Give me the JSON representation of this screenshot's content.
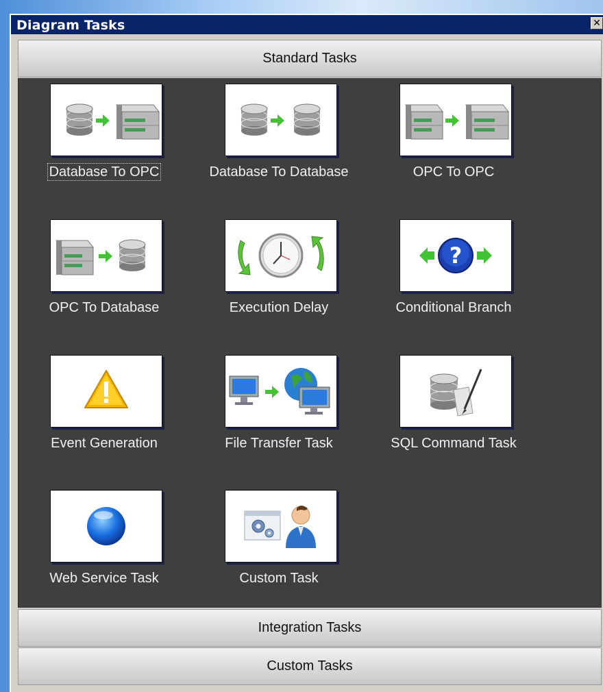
{
  "window": {
    "title": "Diagram Tasks",
    "close_glyph": "✕"
  },
  "sections": {
    "standard": "Standard Tasks",
    "integration": "Integration Tasks",
    "custom": "Custom Tasks"
  },
  "tasks": [
    {
      "label": "Database To OPC",
      "icon": "database-to-opc-icon",
      "focused": true
    },
    {
      "label": "Database To Database",
      "icon": "database-to-database-icon"
    },
    {
      "label": "OPC To OPC",
      "icon": "opc-to-opc-icon"
    },
    {
      "label": "OPC To Database",
      "icon": "opc-to-database-icon"
    },
    {
      "label": "Execution Delay",
      "icon": "clock-delay-icon"
    },
    {
      "label": "Conditional Branch",
      "icon": "question-branch-icon"
    },
    {
      "label": "Event Generation",
      "icon": "warning-event-icon"
    },
    {
      "label": "File Transfer Task",
      "icon": "file-transfer-icon"
    },
    {
      "label": "SQL Command Task",
      "icon": "sql-command-icon"
    },
    {
      "label": "Web Service Task",
      "icon": "globe-web-service-icon"
    },
    {
      "label": "Custom Task",
      "icon": "custom-task-icon"
    }
  ],
  "colors": {
    "titlebar": "#0a246a",
    "panel": "#3f3f3f",
    "arrow": "#44c236"
  }
}
